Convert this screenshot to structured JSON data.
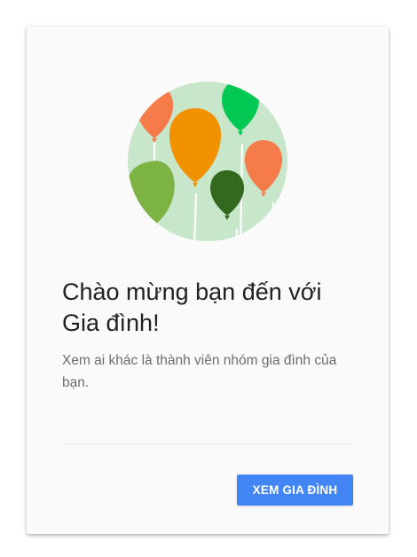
{
  "welcome_card": {
    "title": "Chào mừng bạn đến với Gia đình!",
    "description": "Xem ai khác là thành viên nhóm gia đình của bạn.",
    "primary_button_label": "XEM GIA ĐÌNH",
    "accent_color": "#4285f4"
  },
  "illustration": {
    "icon": "balloons-icon",
    "colors": {
      "background_circle": "#c8e6c9",
      "orange": "#f57c4a",
      "amber": "#f29100",
      "bright_green": "#00c853",
      "light_green": "#7cb342",
      "dark_green": "#33691e"
    }
  }
}
